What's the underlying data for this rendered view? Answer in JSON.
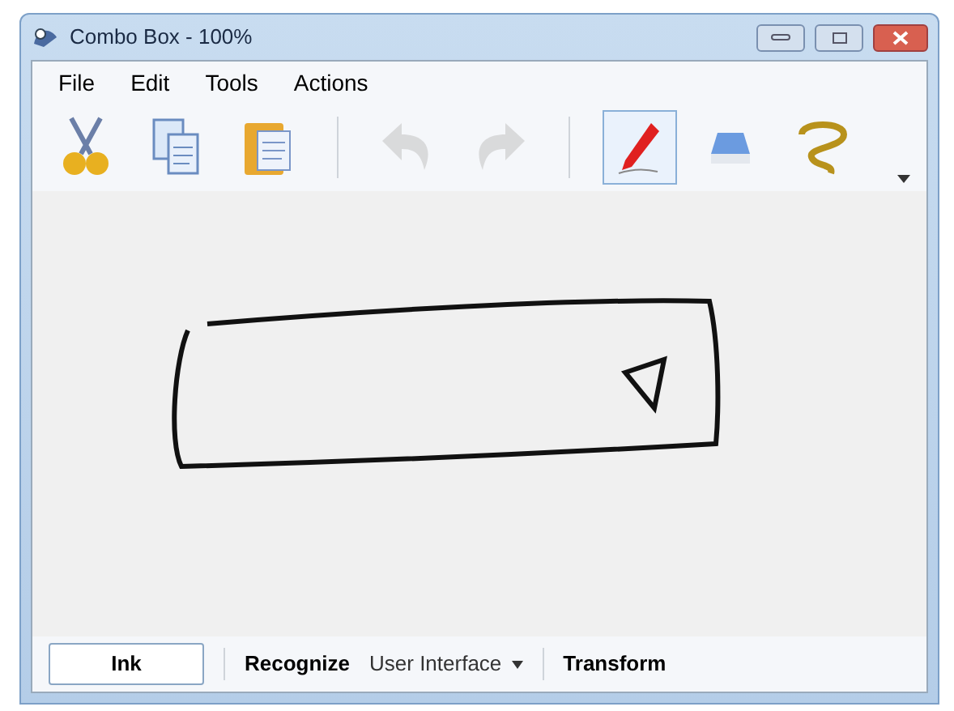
{
  "window": {
    "title": "Combo Box - 100%"
  },
  "menu": [
    "File",
    "Edit",
    "Tools",
    "Actions"
  ],
  "toolbar": [
    {
      "kind": "cut",
      "selected": false,
      "disabled": false
    },
    {
      "kind": "copy",
      "selected": false,
      "disabled": false
    },
    {
      "kind": "paste",
      "selected": false,
      "disabled": false
    },
    {
      "kind": "separator"
    },
    {
      "kind": "undo",
      "selected": false,
      "disabled": true
    },
    {
      "kind": "redo",
      "selected": false,
      "disabled": true
    },
    {
      "kind": "separator"
    },
    {
      "kind": "pen",
      "selected": true,
      "disabled": false
    },
    {
      "kind": "eraser",
      "selected": false,
      "disabled": false
    },
    {
      "kind": "lasso",
      "selected": false,
      "disabled": false
    }
  ],
  "bottom_bar": [
    {
      "kind": "mode",
      "label": "Ink",
      "selected": true
    },
    {
      "kind": "separator"
    },
    {
      "kind": "mode",
      "label": "Recognize",
      "selected": false
    },
    {
      "kind": "dropdown",
      "label": "User Interface"
    },
    {
      "kind": "separator"
    },
    {
      "kind": "mode",
      "label": "Transform",
      "selected": false
    }
  ]
}
